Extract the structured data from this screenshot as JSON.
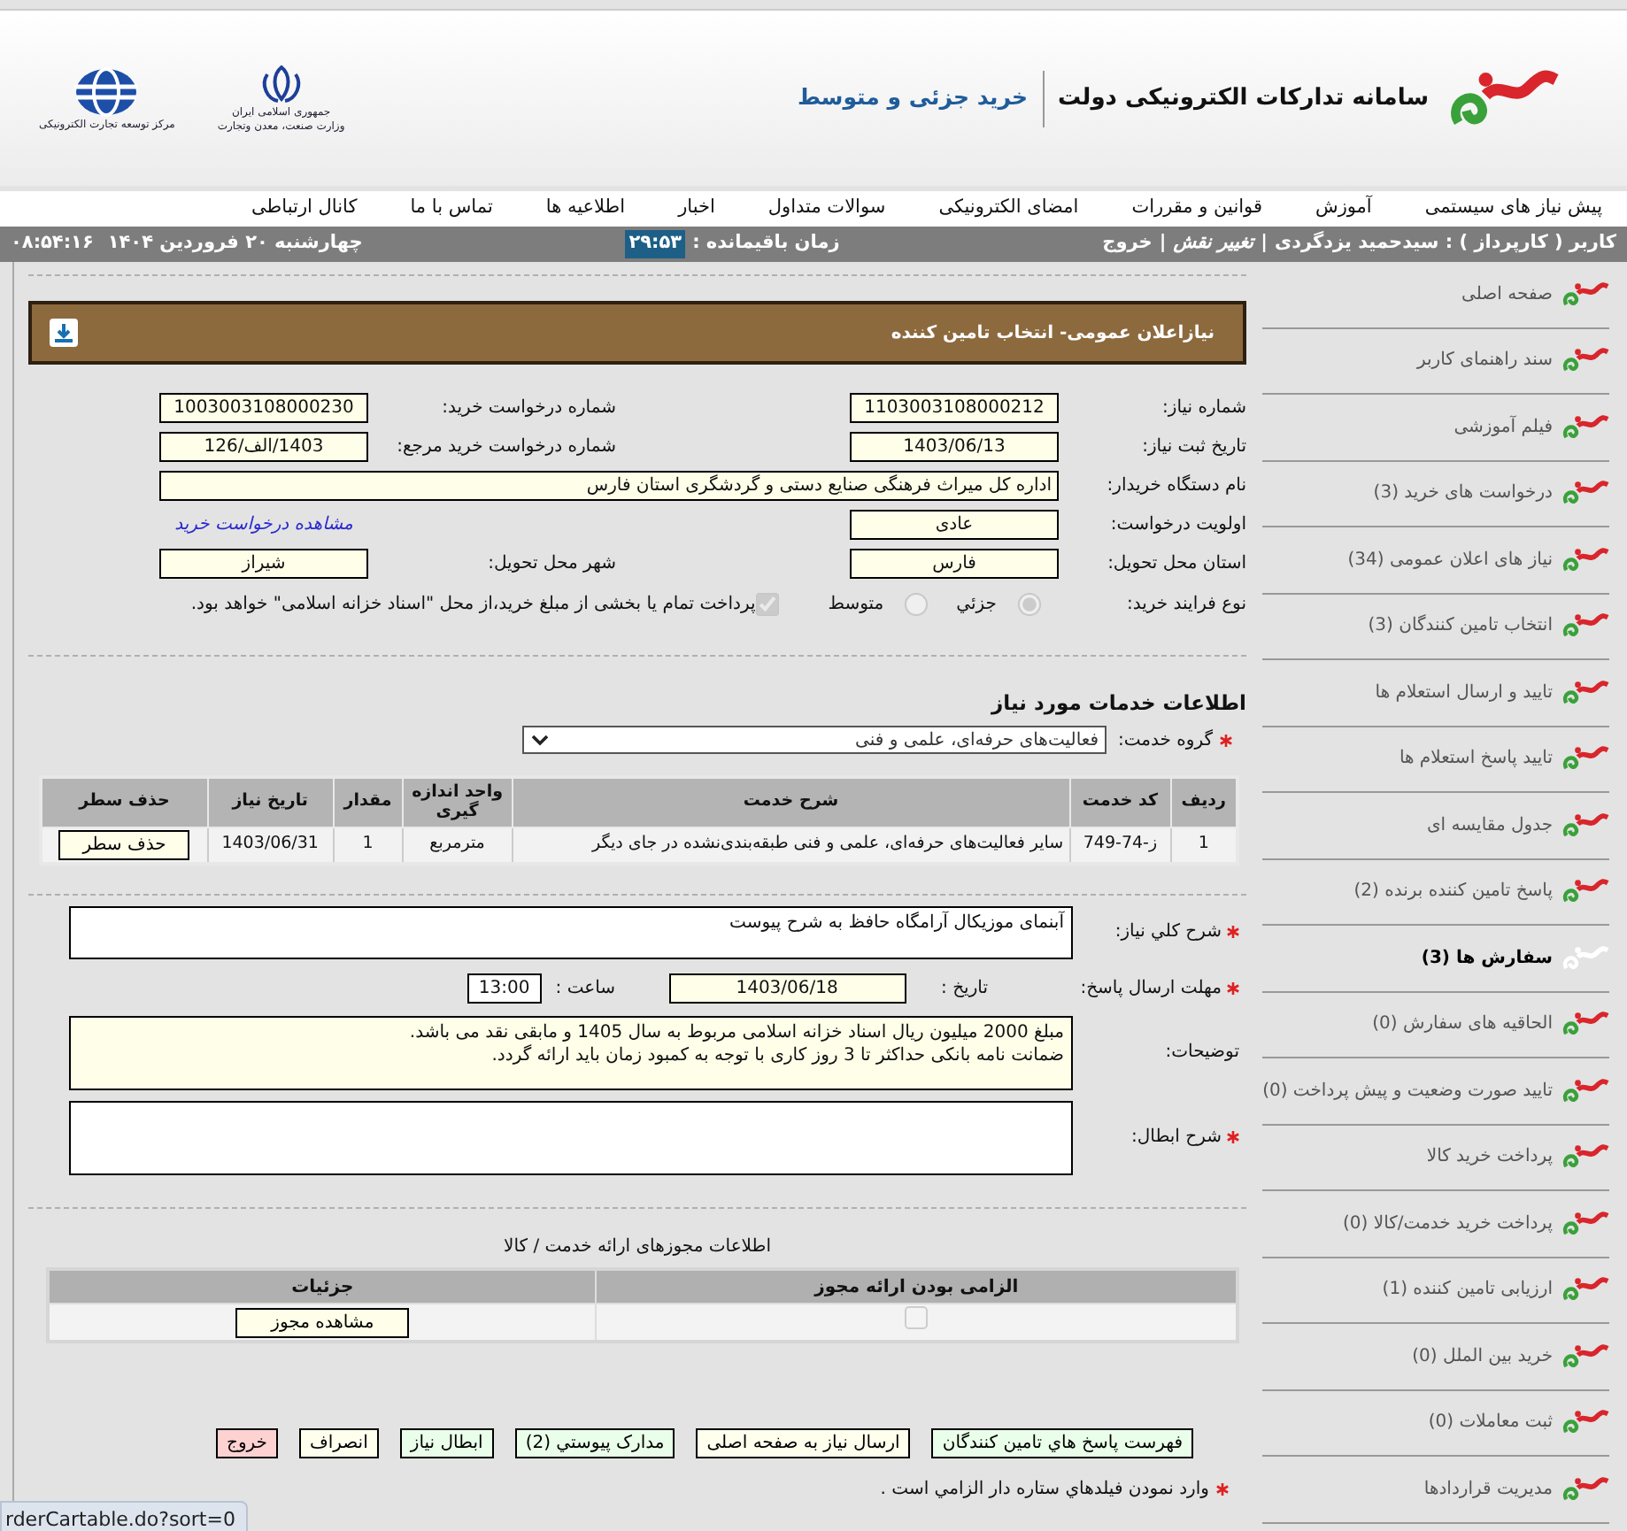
{
  "header": {
    "title": "سامانه تدارکات الکترونیکی دولت",
    "subtitle": "خرید جزئی و متوسط",
    "emblem_caption": [
      "جمهوری اسلامی ایران",
      "وزارت صنعت، معدن وتجارت"
    ],
    "center_caption": "مرکز توسعه تجارت الکترونیکی"
  },
  "menu": [
    "پیش نیاز های سیستمی",
    "آموزش",
    "قوانین و مقررات",
    "امضای الکترونیکی",
    "سوالات متداول",
    "اخبار",
    "اطلاعیه ها",
    "تماس با ما",
    "کانال ارتباطی"
  ],
  "user_bar": {
    "items": [
      {
        "kind": "label",
        "text": "کاربر ( کارپرداز ) : سیدحمید یزدگردی"
      },
      {
        "kind": "separator",
        "text": "|"
      },
      {
        "kind": "link",
        "text": "تغییر نقش"
      },
      {
        "kind": "separator",
        "text": "|"
      },
      {
        "kind": "plain",
        "text": "خروج"
      }
    ],
    "timer_label": "زمان باقیمانده :",
    "timer": "۲۹:۵۳",
    "time": "۰۸:۵۴:۱۶",
    "date": "چهارشنبه ۲۰ فروردین ۱۴۰۴"
  },
  "panel": {
    "title": "نیازاعلان عمومی- انتخاب تامین کننده"
  },
  "form": {
    "rows": [
      {
        "cells": [
          {
            "kind": "label",
            "text": "شماره نیاز:"
          },
          {
            "kind": "field",
            "value": "1103003108000212"
          },
          {
            "kind": "label",
            "text": "شماره درخواست خرید:"
          },
          {
            "kind": "field",
            "value": "1003003108000230"
          }
        ]
      },
      {
        "cells": [
          {
            "kind": "label",
            "text": "تاریخ ثبت نیاز:"
          },
          {
            "kind": "field",
            "value": "1403/06/13"
          },
          {
            "kind": "label",
            "text": "شماره درخواست خرید مرجع:"
          },
          {
            "kind": "field",
            "value": "1403/الف/126"
          }
        ]
      },
      {
        "cells": [
          {
            "kind": "label",
            "text": "نام دستگاه خریدار:"
          },
          {
            "kind": "wide_field",
            "value": "اداره کل میراث فرهنگی  صنایع دستی و گردشگری استان فارس"
          }
        ]
      },
      {
        "cells": [
          {
            "kind": "label",
            "text": "اولویت درخواست:"
          },
          {
            "kind": "field",
            "value": "عادی"
          },
          {
            "kind": "label",
            "text": ""
          },
          {
            "kind": "link",
            "text": "مشاهده درخواست خرید"
          }
        ]
      },
      {
        "cells": [
          {
            "kind": "label",
            "text": "استان محل تحویل:"
          },
          {
            "kind": "field",
            "value": "فارس"
          },
          {
            "kind": "label",
            "text": "شهر محل تحویل:"
          },
          {
            "kind": "field",
            "value": "شیراز"
          }
        ]
      }
    ],
    "process": {
      "label": "نوع فرایند خرید:",
      "options": [
        {
          "text": "جزئي",
          "selected": true
        },
        {
          "text": "متوسط",
          "selected": false
        }
      ],
      "note": {
        "checked": true,
        "text": "پرداخت تمام یا بخشی از مبلغ خرید،از محل \"اسناد خزانه اسلامی\" خواهد بود."
      }
    }
  },
  "services": {
    "title": "اطلاعات خدمات مورد نیاز",
    "group": {
      "label": "گروه خدمت:",
      "required": true,
      "value": "فعالیت‌های حرفه‌ای، علمی و فنی"
    },
    "columns": [
      "ردیف",
      "کد خدمت",
      "شرح خدمت",
      "واحد اندازه گیری",
      "مقدار",
      "تاریخ نیاز",
      "حذف سطر"
    ],
    "rows": [
      {
        "cells": [
          "1",
          "ز-74-749",
          "سایر فعالیت‌های حرفه‌ای، علمی و فنی طبقه‌بندی‌نشده در جای دیگر",
          "مترمربع",
          "1",
          "1403/06/31"
        ],
        "button": "حذف سطر"
      }
    ]
  },
  "general_description": {
    "label": "شرح کلي نیاز:",
    "required": true,
    "readonly": false,
    "value": "آبنمای موزیکال آرامگاه حافظ به شرح پیوست"
  },
  "deadline": {
    "label": "مهلت ارسال پاسخ:",
    "required": true,
    "date_label": "تاریخ :",
    "date": "1403/06/18",
    "time_label": "ساعت :",
    "time": "13:00"
  },
  "notes": {
    "label": "توضیحات:",
    "required": false,
    "readonly": true,
    "value": "مبلغ 2000 میلیون ریال اسناد خزانه اسلامی مربوط به سال 1405 و مابقی نقد می باشد.\nضمانت نامه بانکی حداکثر تا 3 روز کاری با توجه به کمبود زمان باید ارائه گردد."
  },
  "cancel_reason": {
    "label": "شرح ابطال:",
    "required": true,
    "readonly": false
  },
  "licenses": {
    "caption": "اطلاعات مجوزهای ارائه خدمت / کالا",
    "columns": [
      "الزامی بودن ارائه مجوز",
      "جزئیات"
    ],
    "rows": [
      {
        "required": false,
        "button": "مشاهده مجوز"
      }
    ]
  },
  "buttons": [
    {
      "label": "فهرست پاسخ هاي تامين كنندگان",
      "color": "#eaffea"
    },
    {
      "label": "ارسال نیاز به صفحه اصلی",
      "color": "#ffffee"
    },
    {
      "label": "مدارک پیوستي (2)",
      "color": "#eaffea"
    },
    {
      "label": "ابطال نیاز",
      "color": "#eaffea"
    },
    {
      "label": "انصراف",
      "color": "#ffffee"
    },
    {
      "label": "خروج",
      "color": "#ffd2d2"
    }
  ],
  "footer_note": {
    "text": "وارد نمودن فیلدهاي ستاره دار الزامي است ."
  },
  "sidebar": {
    "items": [
      {
        "label": "صفحه اصلی",
        "selected": false
      },
      {
        "label": "سند راهنمای کاربر",
        "selected": false
      },
      {
        "label": "فیلم آموزشی",
        "selected": false
      },
      {
        "label": "درخواست های خرید (3)",
        "selected": false
      },
      {
        "label": "نیاز های اعلان عمومی (34)",
        "selected": false
      },
      {
        "label": "انتخاب تامین کنندگان (3)",
        "selected": false
      },
      {
        "label": "تایید و ارسال استعلام ها",
        "selected": false
      },
      {
        "label": "تایید پاسخ استعلام ها",
        "selected": false
      },
      {
        "label": "جدول مقایسه ای",
        "selected": false
      },
      {
        "label": "پاسخ تامین کننده برنده (2)",
        "selected": false
      },
      {
        "label": "سفارش ها (3)",
        "selected": true
      },
      {
        "label": "الحاقیه های سفارش (0)",
        "selected": false
      },
      {
        "label": "تایید صورت وضعیت و پیش پرداخت (0)",
        "selected": false
      },
      {
        "label": "پرداخت خرید کالا",
        "selected": false
      },
      {
        "label": "پرداخت خرید خدمت/کالا (0)",
        "selected": false
      },
      {
        "label": "ارزیابی تامین کننده (1)",
        "selected": false
      },
      {
        "label": "خرید بین الملل  (0)",
        "selected": false
      },
      {
        "label": "ثبت معاملات  (0)",
        "selected": false
      },
      {
        "label": "مدیریت قراردادها",
        "selected": false
      }
    ]
  },
  "status_url": "rderCartable.do?sort=0"
}
